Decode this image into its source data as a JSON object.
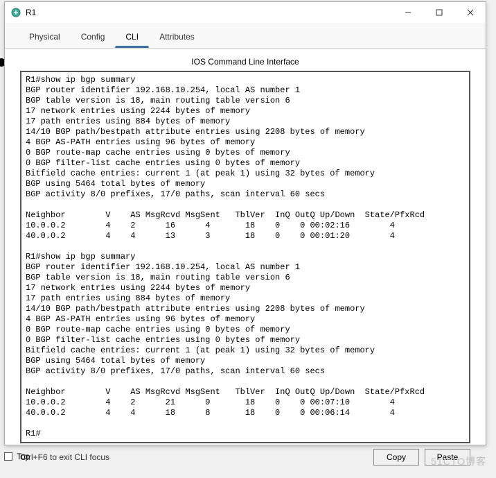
{
  "window": {
    "title": "R1",
    "icon": "router-icon"
  },
  "tabs": {
    "items": [
      "Physical",
      "Config",
      "CLI",
      "Attributes"
    ],
    "active_index": 2
  },
  "cli": {
    "subtitle": "IOS Command Line Interface",
    "hint": "Ctrl+F6 to exit CLI focus",
    "copy_label": "Copy",
    "paste_label": "Paste",
    "output": "R1#show ip bgp summary\nBGP router identifier 192.168.10.254, local AS number 1\nBGP table version is 18, main routing table version 6\n17 network entries using 2244 bytes of memory\n17 path entries using 884 bytes of memory\n14/10 BGP path/bestpath attribute entries using 2208 bytes of memory\n4 BGP AS-PATH entries using 96 bytes of memory\n0 BGP route-map cache entries using 0 bytes of memory\n0 BGP filter-list cache entries using 0 bytes of memory\nBitfield cache entries: current 1 (at peak 1) using 32 bytes of memory\nBGP using 5464 total bytes of memory\nBGP activity 8/0 prefixes, 17/0 paths, scan interval 60 secs\n\nNeighbor        V    AS MsgRcvd MsgSent   TblVer  InQ OutQ Up/Down  State/PfxRcd\n10.0.0.2        4    2      16      4       18    0    0 00:02:16        4\n40.0.0.2        4    4      13      3       18    0    0 00:01:20        4\n\nR1#show ip bgp summary\nBGP router identifier 192.168.10.254, local AS number 1\nBGP table version is 18, main routing table version 6\n17 network entries using 2244 bytes of memory\n17 path entries using 884 bytes of memory\n14/10 BGP path/bestpath attribute entries using 2208 bytes of memory\n4 BGP AS-PATH entries using 96 bytes of memory\n0 BGP route-map cache entries using 0 bytes of memory\n0 BGP filter-list cache entries using 0 bytes of memory\nBitfield cache entries: current 1 (at peak 1) using 32 bytes of memory\nBGP using 5464 total bytes of memory\nBGP activity 8/0 prefixes, 17/0 paths, scan interval 60 secs\n\nNeighbor        V    AS MsgRcvd MsgSent   TblVer  InQ OutQ Up/Down  State/PfxRcd\n10.0.0.2        4    2      21      9       18    0    0 00:07:10        4\n40.0.0.2        4    4      18      8       18    0    0 00:06:14        4\n\nR1#"
  },
  "bottom": {
    "top_label": "Top",
    "top_checked": false
  },
  "watermark": "51CTO博客"
}
